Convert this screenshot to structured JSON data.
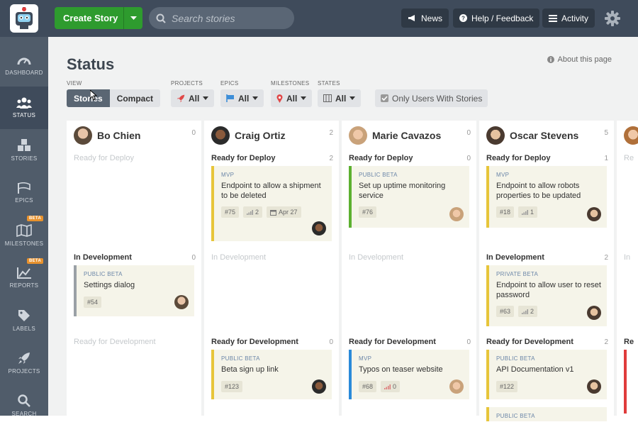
{
  "topbar": {
    "create_label": "Create Story",
    "search_placeholder": "Search stories",
    "news": "News",
    "help": "Help / Feedback",
    "activity": "Activity"
  },
  "sidebar": {
    "items": [
      {
        "label": "DASHBOARD"
      },
      {
        "label": "STATUS"
      },
      {
        "label": "STORIES"
      },
      {
        "label": "EPICS"
      },
      {
        "label": "MILESTONES",
        "badge": "BETA"
      },
      {
        "label": "REPORTS",
        "badge": "BETA"
      },
      {
        "label": "LABELS"
      },
      {
        "label": "PROJECTS"
      },
      {
        "label": "SEARCH"
      }
    ]
  },
  "page": {
    "title": "Status",
    "about": "About this page"
  },
  "filters": {
    "view_label": "VIEW",
    "view_stories": "Stories",
    "view_compact": "Compact",
    "projects_label": "PROJECTS",
    "projects_value": "All",
    "epics_label": "EPICS",
    "epics_value": "All",
    "milestones_label": "MILESTONES",
    "milestones_value": "All",
    "states_label": "STATES",
    "states_value": "All",
    "only_users": "Only Users With Stories"
  },
  "colors": {
    "accent": "#2e9b2e",
    "topbar": "#3f4b5b",
    "sidebar": "#505c6a",
    "card_bg": "#f5f4e9",
    "yellow": "#e7c53a",
    "green": "#5cb030",
    "blue": "#2a8ad9",
    "grey": "#9aa0a6",
    "red": "#e03c3c"
  },
  "columns": [
    {
      "name": "Bo Chien",
      "count": "0",
      "sections": [
        {
          "label": "Ready for Deploy",
          "count": "",
          "empty": true
        },
        {
          "label": "In Development",
          "count": "0",
          "empty": false,
          "cards": [
            {
              "label": "PUBLIC BETA",
              "title": "Settings dialog",
              "id": "#54"
            }
          ]
        },
        {
          "label": "Ready for Development",
          "count": "",
          "empty": true
        }
      ]
    },
    {
      "name": "Craig Ortiz",
      "count": "2",
      "sections": [
        {
          "label": "Ready for Deploy",
          "count": "2",
          "empty": false,
          "cards": [
            {
              "label": "MVP",
              "title": "Endpoint to allow a shipment to be deleted",
              "id": "#75",
              "est": "2",
              "date": "Apr 27"
            }
          ]
        },
        {
          "label": "In Development",
          "count": "",
          "empty": true
        },
        {
          "label": "Ready for Development",
          "count": "0",
          "empty": false,
          "cards": [
            {
              "label": "PUBLIC BETA",
              "title": "Beta sign up link",
              "id": "#123"
            }
          ]
        }
      ]
    },
    {
      "name": "Marie Cavazos",
      "count": "0",
      "sections": [
        {
          "label": "Ready for Deploy",
          "count": "0",
          "empty": false,
          "cards": [
            {
              "label": "PUBLIC BETA",
              "title": "Set up uptime monitoring service",
              "id": "#76"
            }
          ]
        },
        {
          "label": "In Development",
          "count": "",
          "empty": true
        },
        {
          "label": "Ready for Development",
          "count": "0",
          "empty": false,
          "cards": [
            {
              "label": "MVP",
              "title": "Typos on teaser website",
              "id": "#68",
              "est": "0"
            }
          ]
        }
      ]
    },
    {
      "name": "Oscar Stevens",
      "count": "5",
      "sections": [
        {
          "label": "Ready for Deploy",
          "count": "1",
          "empty": false,
          "cards": [
            {
              "label": "MVP",
              "title": "Endpoint to allow robots properties to be updated",
              "id": "#18",
              "est": "1"
            }
          ]
        },
        {
          "label": "In Development",
          "count": "2",
          "empty": false,
          "cards": [
            {
              "label": "PRIVATE BETA",
              "title": "Endpoint to allow user to reset password",
              "id": "#63",
              "est": "2"
            }
          ]
        },
        {
          "label": "Ready for Development",
          "count": "2",
          "empty": false,
          "cards": [
            {
              "label": "PUBLIC BETA",
              "title": "API Documentation v1",
              "id": "#122"
            },
            {
              "label": "PUBLIC BETA",
              "title": "",
              "id": ""
            }
          ]
        }
      ]
    },
    {
      "name": "",
      "count": "",
      "sections": [
        {
          "label": "Re",
          "empty": true
        },
        {
          "label": "In",
          "empty": true
        },
        {
          "label": "Re",
          "empty": false
        }
      ]
    }
  ]
}
